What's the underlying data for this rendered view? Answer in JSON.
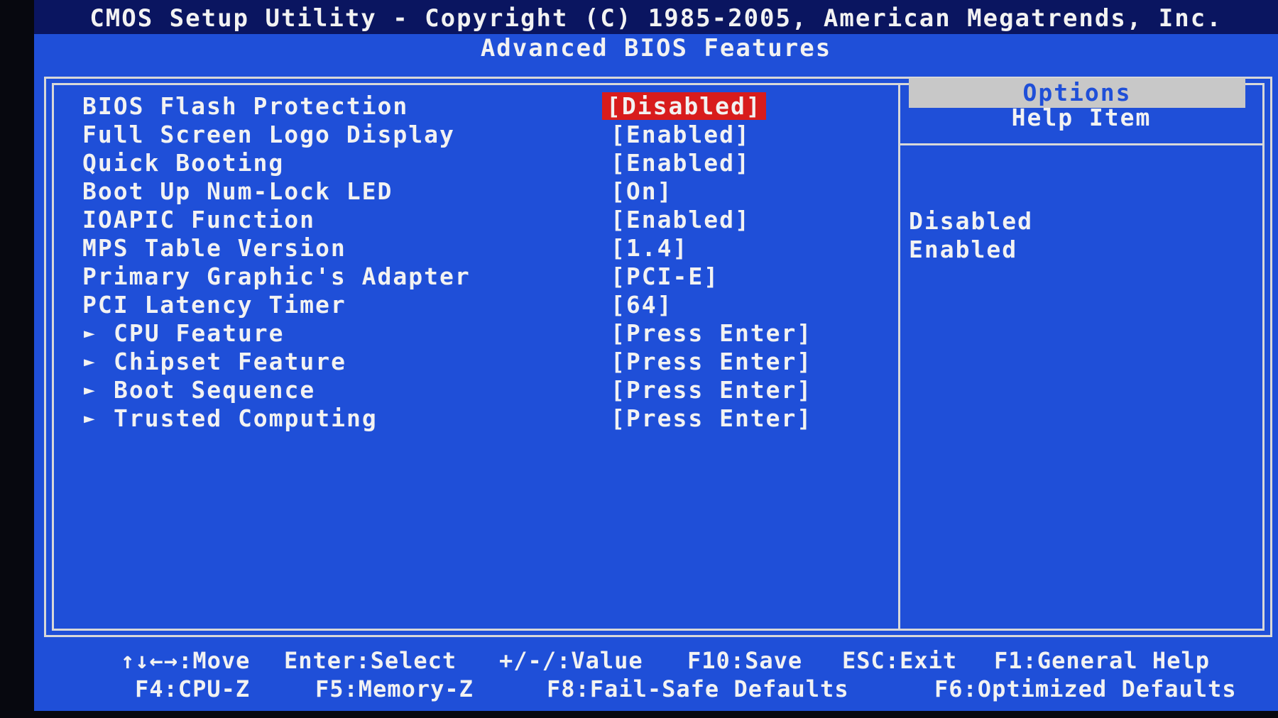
{
  "header": {
    "title": "CMOS Setup Utility - Copyright (C) 1985-2005, American Megatrends, Inc.",
    "subtitle": "Advanced BIOS Features"
  },
  "settings": [
    {
      "label": "BIOS Flash Protection",
      "value": "[Disabled]"
    },
    {
      "label": "Full Screen Logo Display",
      "value": "[Enabled]"
    },
    {
      "label": "Quick Booting",
      "value": "[Enabled]"
    },
    {
      "label": "Boot Up Num-Lock LED",
      "value": "[On]"
    },
    {
      "label": "IOAPIC Function",
      "value": "[Enabled]"
    },
    {
      "label": "MPS Table Version",
      "value": "[1.4]"
    },
    {
      "label": "Primary Graphic's Adapter",
      "value": "[PCI-E]"
    },
    {
      "label": "PCI Latency Timer",
      "value": "[64]"
    },
    {
      "label": "CPU Feature",
      "value": "[Press Enter]"
    },
    {
      "label": "Chipset Feature",
      "value": "[Press Enter]"
    },
    {
      "label": "Boot Sequence",
      "value": "[Press Enter]"
    },
    {
      "label": "Trusted Computing",
      "value": "[Press Enter]"
    }
  ],
  "help": {
    "title": "Help Item",
    "options_label": "Options",
    "options": [
      "Disabled",
      "Enabled"
    ]
  },
  "footer": {
    "move": "↑↓←→:Move",
    "select": "Enter:Select",
    "value": "+/-/:Value",
    "save": "F10:Save",
    "exit": "ESC:Exit",
    "general_help": "F1:General Help",
    "cpu_z": "F4:CPU-Z",
    "memory_z": "F5:Memory-Z",
    "fail_safe": "F8:Fail-Safe Defaults",
    "optimized": "F6:Optimized Defaults"
  },
  "colors": {
    "background": "#1f4fd8",
    "selected": "#d81c1c",
    "text": "#f2f2f2"
  }
}
